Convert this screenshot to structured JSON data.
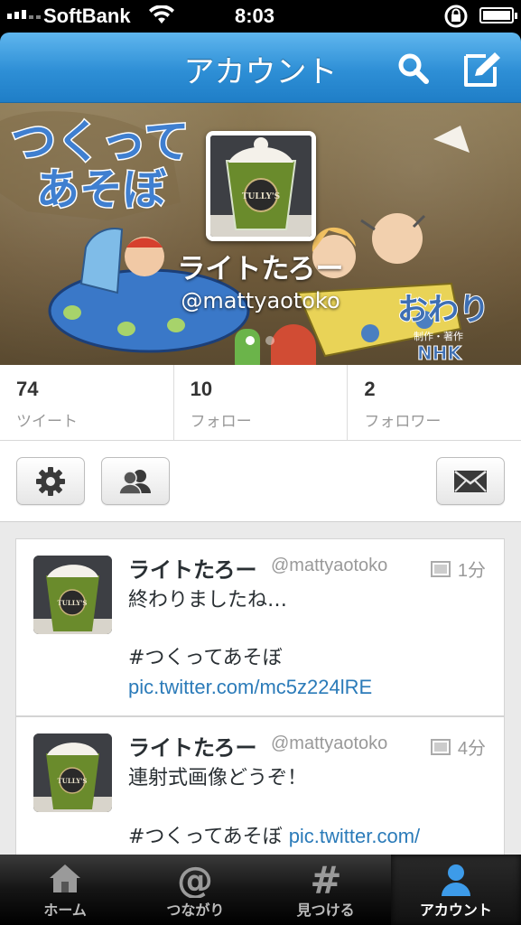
{
  "status": {
    "carrier": "SoftBank",
    "time": "8:03"
  },
  "navbar": {
    "title": "アカウント",
    "search_icon": "search-icon",
    "compose_icon": "compose-icon"
  },
  "profile": {
    "name": "ライトたろー",
    "handle": "@mattyaotoko",
    "banner_text": [
      "つくって",
      "あそぼ",
      "おわり",
      "制作・著作",
      "NHK"
    ],
    "page_dots": 2,
    "active_dot": 0
  },
  "stats": [
    {
      "num": "74",
      "label": "ツイート"
    },
    {
      "num": "10",
      "label": "フォロー"
    },
    {
      "num": "2",
      "label": "フォロワー"
    }
  ],
  "actions": {
    "settings_icon": "gear-icon",
    "people_icon": "people-icon",
    "message_icon": "envelope-icon"
  },
  "tweets": [
    {
      "name": "ライトたろー",
      "handle": "@mattyaotoko",
      "time": "1分",
      "text": "終わりましたね…",
      "tag": "#つくってあそぼ",
      "link": "pic.twitter.com/mc5z224lRE"
    },
    {
      "name": "ライトたろー",
      "handle": "@mattyaotoko",
      "time": "4分",
      "text": "連射式画像どうぞ！",
      "tag": "#つくってあそぼ",
      "link": "pic.twitter.com/"
    }
  ],
  "tabbar": [
    {
      "label": "ホーム",
      "icon": "home-icon",
      "active": false
    },
    {
      "label": "つながり",
      "icon": "at-icon",
      "active": false
    },
    {
      "label": "見つける",
      "icon": "hashtag-icon",
      "active": false
    },
    {
      "label": "アカウント",
      "icon": "person-icon",
      "active": true
    }
  ],
  "colors": {
    "nav_blue": "#2e8fd6",
    "link_blue": "#2b7bb9",
    "active_tab_icon": "#3d9be9"
  }
}
